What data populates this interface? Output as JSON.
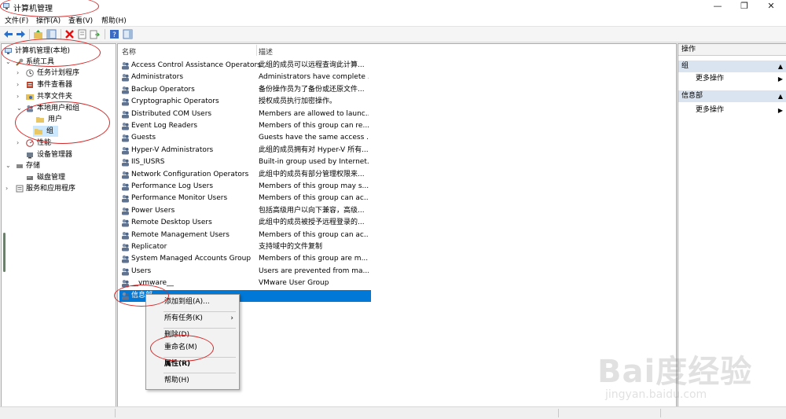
{
  "window": {
    "title": "计算机管理",
    "minimize": "—",
    "restore": "❐",
    "close": "✕"
  },
  "menu": [
    "文件(F)",
    "操作(A)",
    "查看(V)",
    "帮助(H)"
  ],
  "tree": [
    {
      "label": "计算机管理(本地)",
      "level": 0,
      "icon": "computer-icon"
    },
    {
      "label": "系统工具",
      "level": 1,
      "expanded": true,
      "icon": "tools-icon"
    },
    {
      "label": "任务计划程序",
      "level": 2,
      "icon": "clock-icon"
    },
    {
      "label": "事件查看器",
      "level": 2,
      "icon": "event-icon"
    },
    {
      "label": "共享文件夹",
      "level": 2,
      "icon": "share-folder-icon"
    },
    {
      "label": "本地用户和组",
      "level": 2,
      "expanded": true,
      "icon": "users-icon"
    },
    {
      "label": "用户",
      "level": 3,
      "icon": "folder-icon"
    },
    {
      "label": "组",
      "level": 3,
      "icon": "folder-icon",
      "selected": true
    },
    {
      "label": "性能",
      "level": 2,
      "icon": "performance-icon"
    },
    {
      "label": "设备管理器",
      "level": 2,
      "icon": "device-icon"
    },
    {
      "label": "存储",
      "level": 1,
      "expanded": true,
      "icon": "storage-icon"
    },
    {
      "label": "磁盘管理",
      "level": 2,
      "icon": "disk-icon"
    },
    {
      "label": "服务和应用程序",
      "level": 1,
      "icon": "services-icon"
    }
  ],
  "columns": {
    "name": "名称",
    "desc": "描述"
  },
  "groups": [
    {
      "name": "Access Control Assistance Operators",
      "desc": "此组的成员可以远程查询此计算..."
    },
    {
      "name": "Administrators",
      "desc": "Administrators have complete ..."
    },
    {
      "name": "Backup Operators",
      "desc": "备份操作员为了备份或还原文件..."
    },
    {
      "name": "Cryptographic Operators",
      "desc": "授权成员执行加密操作。"
    },
    {
      "name": "Distributed COM Users",
      "desc": "Members are allowed to launc..."
    },
    {
      "name": "Event Log Readers",
      "desc": "Members of this group can re..."
    },
    {
      "name": "Guests",
      "desc": "Guests have the same access ..."
    },
    {
      "name": "Hyper-V Administrators",
      "desc": "此组的成员拥有对 Hyper-V 所有..."
    },
    {
      "name": "IIS_IUSRS",
      "desc": "Built-in group used by Internet..."
    },
    {
      "name": "Network Configuration Operators",
      "desc": "此组中的成员有部分管理权限来..."
    },
    {
      "name": "Performance Log Users",
      "desc": "Members of this group may s..."
    },
    {
      "name": "Performance Monitor Users",
      "desc": "Members of this group can ac..."
    },
    {
      "name": "Power Users",
      "desc": "包括高级用户以向下兼容，高级..."
    },
    {
      "name": "Remote Desktop Users",
      "desc": "此组中的成员被授予远程登录的..."
    },
    {
      "name": "Remote Management Users",
      "desc": "Members of this group can ac..."
    },
    {
      "name": "Replicator",
      "desc": "支持域中的文件复制"
    },
    {
      "name": "System Managed Accounts Group",
      "desc": "Members of this group are m..."
    },
    {
      "name": "Users",
      "desc": "Users are prevented from ma..."
    },
    {
      "name": "__vmware__",
      "desc": "VMware User Group"
    },
    {
      "name": "信息部",
      "desc": "",
      "selected": true
    }
  ],
  "actions": {
    "title": "操作",
    "section1": "组",
    "more1": "更多操作",
    "section2": "信息部",
    "more2": "更多操作"
  },
  "context_menu": {
    "add_to_group": "添加到组(A)...",
    "all_tasks": "所有任务(K)",
    "delete": "删除(D)",
    "rename": "重命名(M)",
    "properties": "属性(R)",
    "help": "帮助(H)"
  },
  "watermark": {
    "brand": "Bai度经验",
    "url": "jingyan.baidu.com"
  },
  "colors": {
    "selection": "#0078d7",
    "annotation": "#d42a2a",
    "tree_selection": "#cce8ff"
  }
}
